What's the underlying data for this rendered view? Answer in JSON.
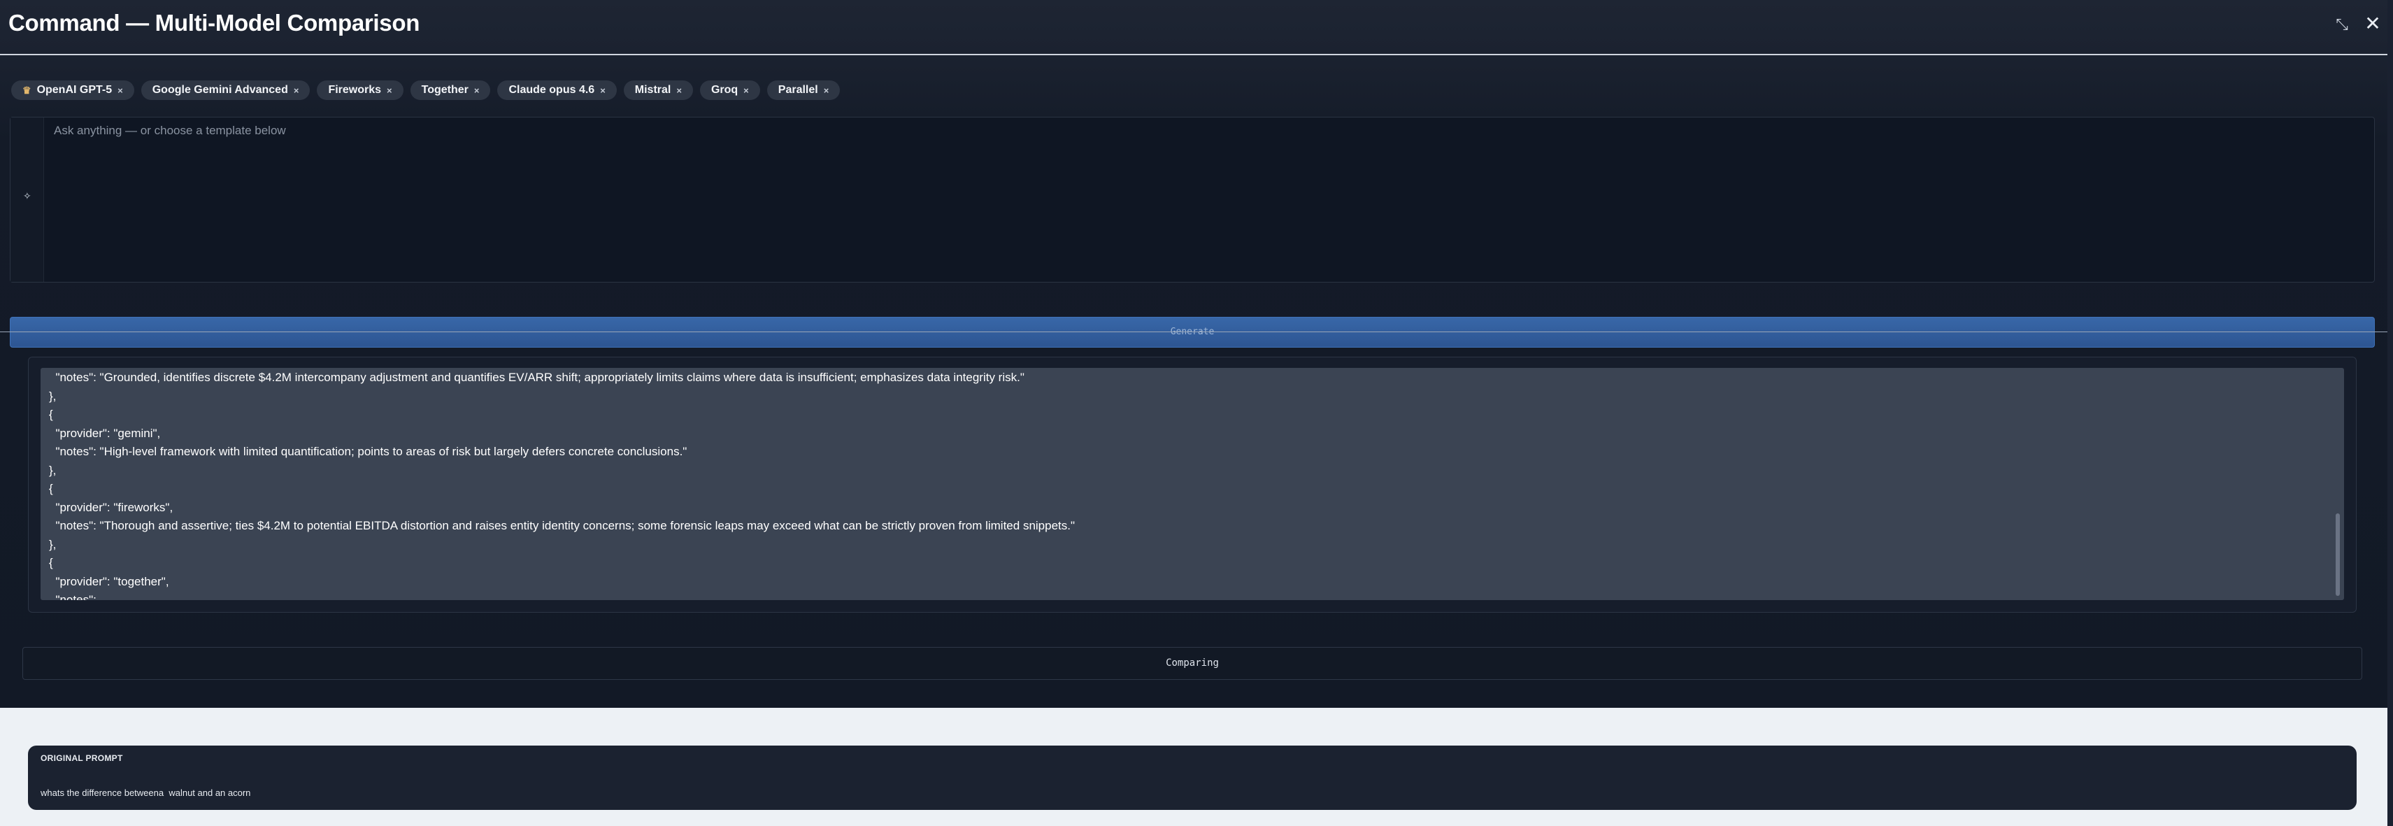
{
  "header": {
    "title": "Command — Multi-Model Comparison",
    "expand_icon": "expand-arrows-icon",
    "close_icon": "close-icon"
  },
  "chips": [
    {
      "label": "OpenAI GPT-5",
      "icon": "crown-icon",
      "remove": "×"
    },
    {
      "label": "Google Gemini Advanced",
      "remove": "×"
    },
    {
      "label": "Fireworks",
      "remove": "×"
    },
    {
      "label": "Together",
      "remove": "×"
    },
    {
      "label": "Claude opus 4.6",
      "remove": "×"
    },
    {
      "label": "Mistral",
      "remove": "×"
    },
    {
      "label": "Groq",
      "remove": "×"
    },
    {
      "label": "Parallel",
      "remove": "×"
    }
  ],
  "prompt": {
    "placeholder": "Ask anything — or choose a template below",
    "value": ""
  },
  "generate": {
    "label": "Generate"
  },
  "output": {
    "lines": [
      "  \"notes\": \"Grounded, identifies discrete $4.2M intercompany adjustment and quantifies EV/ARR shift; appropriately limits claims where data is insufficient; emphasizes data integrity risk.\"",
      "},",
      "{",
      "  \"provider\": \"gemini\",",
      "  \"notes\": \"High-level framework with limited quantification; points to areas of risk but largely defers concrete conclusions.\"",
      "},",
      "{",
      "  \"provider\": \"fireworks\",",
      "  \"notes\": \"Thorough and assertive; ties $4.2M to potential EBITDA distortion and raises entity identity concerns; some forensic leaps may exceed what can be strictly proven from limited snippets.\"",
      "},",
      "{",
      "  \"provider\": \"together\",",
      "  \"notes\":"
    ]
  },
  "comparing": {
    "label": "Comparing"
  },
  "original_prompt": {
    "label": "ORIGINAL PROMPT",
    "text": "whats the difference betweena  walnut and an acorn"
  }
}
